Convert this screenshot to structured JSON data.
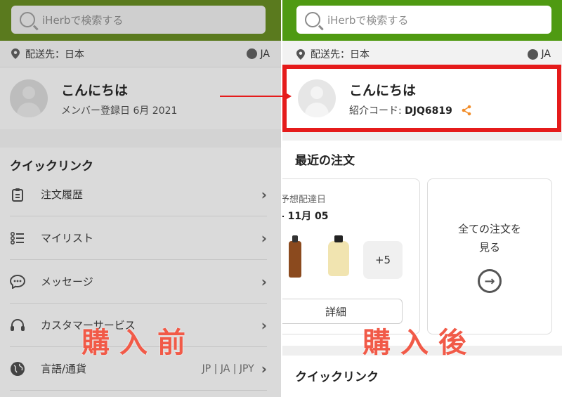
{
  "before": {
    "search_placeholder": "iHerbで検索する",
    "ship_to": "配送先：日本",
    "language": "JA",
    "greeting": "こんにちは",
    "member_since": "メンバー登録日 6月 2021",
    "quick_links_title": "クイックリンク",
    "menu": [
      {
        "label": "注文履歴",
        "icon": "clipboard-icon"
      },
      {
        "label": "マイリスト",
        "icon": "list-icon"
      },
      {
        "label": "メッセージ",
        "icon": "chat-icon"
      },
      {
        "label": "カスタマーサービス",
        "icon": "headset-icon"
      },
      {
        "label": "言語/通貨",
        "icon": "globe-icon",
        "extra": "JP | JA | JPY"
      }
    ],
    "overlay": "購入前"
  },
  "after": {
    "search_placeholder": "iHerbで検索する",
    "ship_to": "配送先：日本",
    "language": "JA",
    "greeting": "こんにちは",
    "referral_label": "紹介コード:",
    "referral_code": "DJQ6819",
    "recent_orders_title": "最近の注文",
    "eta_label": "予想配達日",
    "eta_date": "- 11月 05",
    "more_count": "+5",
    "detail_button": "詳細",
    "all_orders_line1": "全ての注文を",
    "all_orders_line2": "見る",
    "quick_links_title": "クイックリンク",
    "overlay": "購入後"
  },
  "colors": {
    "accent_red": "#e51b1b",
    "overlay_red": "#f15a48",
    "brand_green": "#4f9a12",
    "share_orange": "#f28c28"
  }
}
